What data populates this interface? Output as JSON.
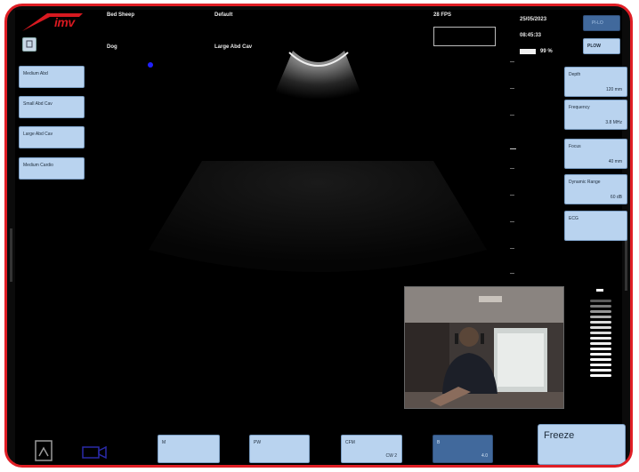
{
  "colors": {
    "bezel": "#e01e25",
    "screen": "#000000",
    "button": "#b9d3ef",
    "button_border": "#7b9ec4",
    "button_dark": "#41699c"
  },
  "brand": {
    "logo_text": "imv"
  },
  "header": {
    "exam": "Bed Sheep",
    "preset": "Default",
    "species": "Dog",
    "probe": "Large Abd Cav",
    "fps": "28 FPS",
    "date": "25/05/2023",
    "time": "08:45:33",
    "battery": "99 %",
    "slot_label": "Pl-LO",
    "pl_label": "PLOW"
  },
  "left_presets": [
    {
      "label": "Medium Abd"
    },
    {
      "label": "Small Abd Cav"
    },
    {
      "label": "Large Abd Cav"
    },
    {
      "label": "Medium Cardio"
    }
  ],
  "right_params": [
    {
      "label": "Depth",
      "value": "120 mm"
    },
    {
      "label": "Frequency",
      "value": "3.8 MHz"
    },
    {
      "label": "Focus",
      "value": "40 mm"
    },
    {
      "label": "Dynamic Range",
      "value": "60 dB"
    },
    {
      "label": "ECG",
      "value": ""
    }
  ],
  "bottom_buttons": [
    {
      "label": "M",
      "value": ""
    },
    {
      "label": "PW",
      "value": ""
    },
    {
      "label": "CFM",
      "value": "CW 2"
    },
    {
      "label": "B",
      "value": "4.0"
    }
  ],
  "freeze": {
    "label": "Freeze"
  },
  "icons": {
    "cine": "cine-icon",
    "camera": "camera-icon",
    "settings": "settings-icon"
  }
}
